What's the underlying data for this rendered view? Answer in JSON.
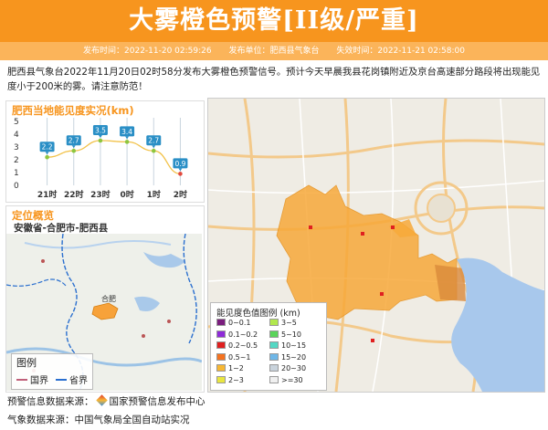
{
  "header": {
    "title": "大雾橙色预警[II级/严重]"
  },
  "meta": {
    "issue_time": "发布时间：2022-11-20 02:59:26",
    "issuer": "发布单位：肥西县气象台",
    "expire_time": "失效时间：2022-11-21 02:58:00"
  },
  "description": "肥西县气象台2022年11月20日02时58分发布大雾橙色预警信号。预计今天早晨我县花岗镇附近及京台高速部分路段将出现能见度小于200米的雾。请注意防范！",
  "visibility_panel": {
    "title": "肥西当地能见度实况(km)"
  },
  "chart_data": {
    "type": "line",
    "title": "肥西当地能见度实况(km)",
    "categories": [
      "21时",
      "22时",
      "23时",
      "0时",
      "1时",
      "2时"
    ],
    "values": [
      2.2,
      2.7,
      3.5,
      3.4,
      2.7,
      0.9
    ],
    "labels": [
      "2.2",
      "2.7",
      "3.5",
      "3.4",
      "2.7",
      "0.9"
    ],
    "yticks": [
      "0",
      "1",
      "2",
      "3",
      "4",
      "5"
    ],
    "ylim": [
      0,
      5
    ],
    "colors": {
      "line": "#f2c24a",
      "marker_label_bg": "#2a8fc6",
      "last_marker_label_bg": "#2a8fc6",
      "point": "#8dc63f",
      "last_point": "#e2483c"
    }
  },
  "location_panel": {
    "title": "定位概览",
    "region": "安徽省-合肥市-肥西县"
  },
  "mini_map": {
    "city_label": "合肥",
    "legend_title": "图例",
    "legend_items": [
      {
        "label": "国界",
        "color": "#c0607a"
      },
      {
        "label": "省界",
        "color": "#2a6fcf"
      }
    ]
  },
  "map_legend": {
    "title": "能见度色值图例 (km)",
    "items": [
      {
        "label": "0~0.1",
        "color": "#7b1d7e"
      },
      {
        "label": "0.1~0.2",
        "color": "#8e2bd8"
      },
      {
        "label": "0.2~0.5",
        "color": "#e02020"
      },
      {
        "label": "0.5~1",
        "color": "#f5721f"
      },
      {
        "label": "1~2",
        "color": "#f7b733"
      },
      {
        "label": "2~3",
        "color": "#e9e640"
      },
      {
        "label": "3~5",
        "color": "#b2e84d"
      },
      {
        "label": "5~10",
        "color": "#5bd45b"
      },
      {
        "label": "10~15",
        "color": "#54d8c4"
      },
      {
        "label": "15~20",
        "color": "#6fb7e8"
      },
      {
        "label": "20~30",
        "color": "#c9d3dc"
      },
      {
        "label": ">=30",
        "color": "#f0f0f0"
      }
    ]
  },
  "footer": {
    "warning_source": "预警信息数据来源：",
    "warning_source_name": "国家预警信息发布中心",
    "weather_source": "气象数据来源：中国气象局全国自动站实况"
  }
}
